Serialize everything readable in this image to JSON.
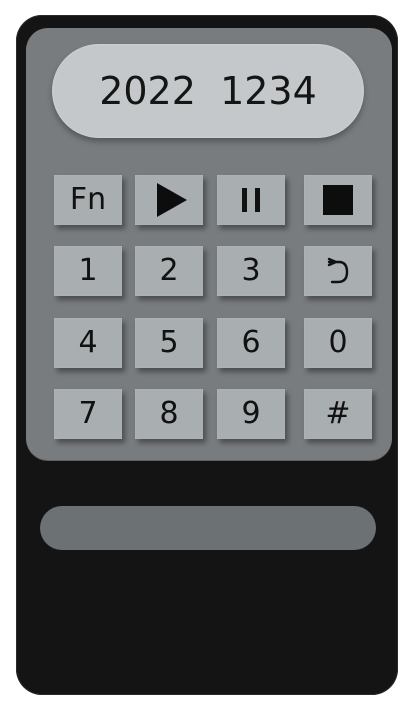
{
  "display": {
    "text": "2022  1234"
  },
  "keypad": {
    "row1": {
      "fn_label": "Fn",
      "play_icon": "play-icon",
      "pause_icon": "pause-icon",
      "stop_icon": "stop-icon"
    },
    "row2": [
      "1",
      "2",
      "3"
    ],
    "row2_back_icon": "return-arrow-icon",
    "row3": [
      "4",
      "5",
      "6",
      "0"
    ],
    "row4": [
      "7",
      "8",
      "9",
      "#"
    ]
  },
  "colors": {
    "body": "#141414",
    "panel": "#787c7e",
    "display": "#c4c8ca",
    "key": "#a9aeb0",
    "slot": "#6c7173"
  }
}
